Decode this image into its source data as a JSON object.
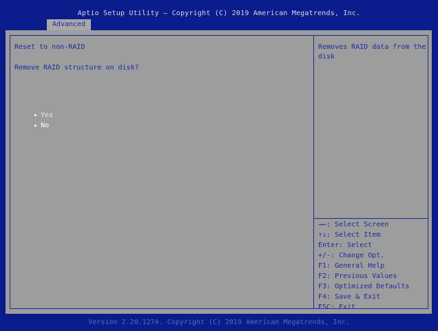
{
  "header": {
    "title": "Aptio Setup Utility – Copyright (C) 2019 American Megatrends, Inc.",
    "active_tab": "Advanced"
  },
  "main": {
    "heading": "Reset to non-RAID",
    "question": "Remove RAID structure on disk?",
    "options": [
      {
        "label": "Yes",
        "arrow": "▸"
      },
      {
        "label": "No",
        "arrow": "▸"
      }
    ]
  },
  "help": {
    "description_line1": "Removes RAID data from the",
    "description_line2": "disk",
    "keys": [
      "→←: Select Screen",
      "↑↓: Select Item",
      "Enter: Select",
      "+/-: Change Opt.",
      "F1: General Help",
      "F2: Previous Values",
      "F3: Optimized Defaults",
      "F4: Save & Exit",
      "ESC: Exit"
    ]
  },
  "footer": {
    "text": "Version 2.20.1274. Copyright (C) 2019 American Megatrends, Inc."
  },
  "colors": {
    "frame_blue": "#0b1c8c",
    "panel_gray": "#9d9d9d",
    "text_blue": "#1a2aa0",
    "highlight_white": "#ffffff"
  }
}
